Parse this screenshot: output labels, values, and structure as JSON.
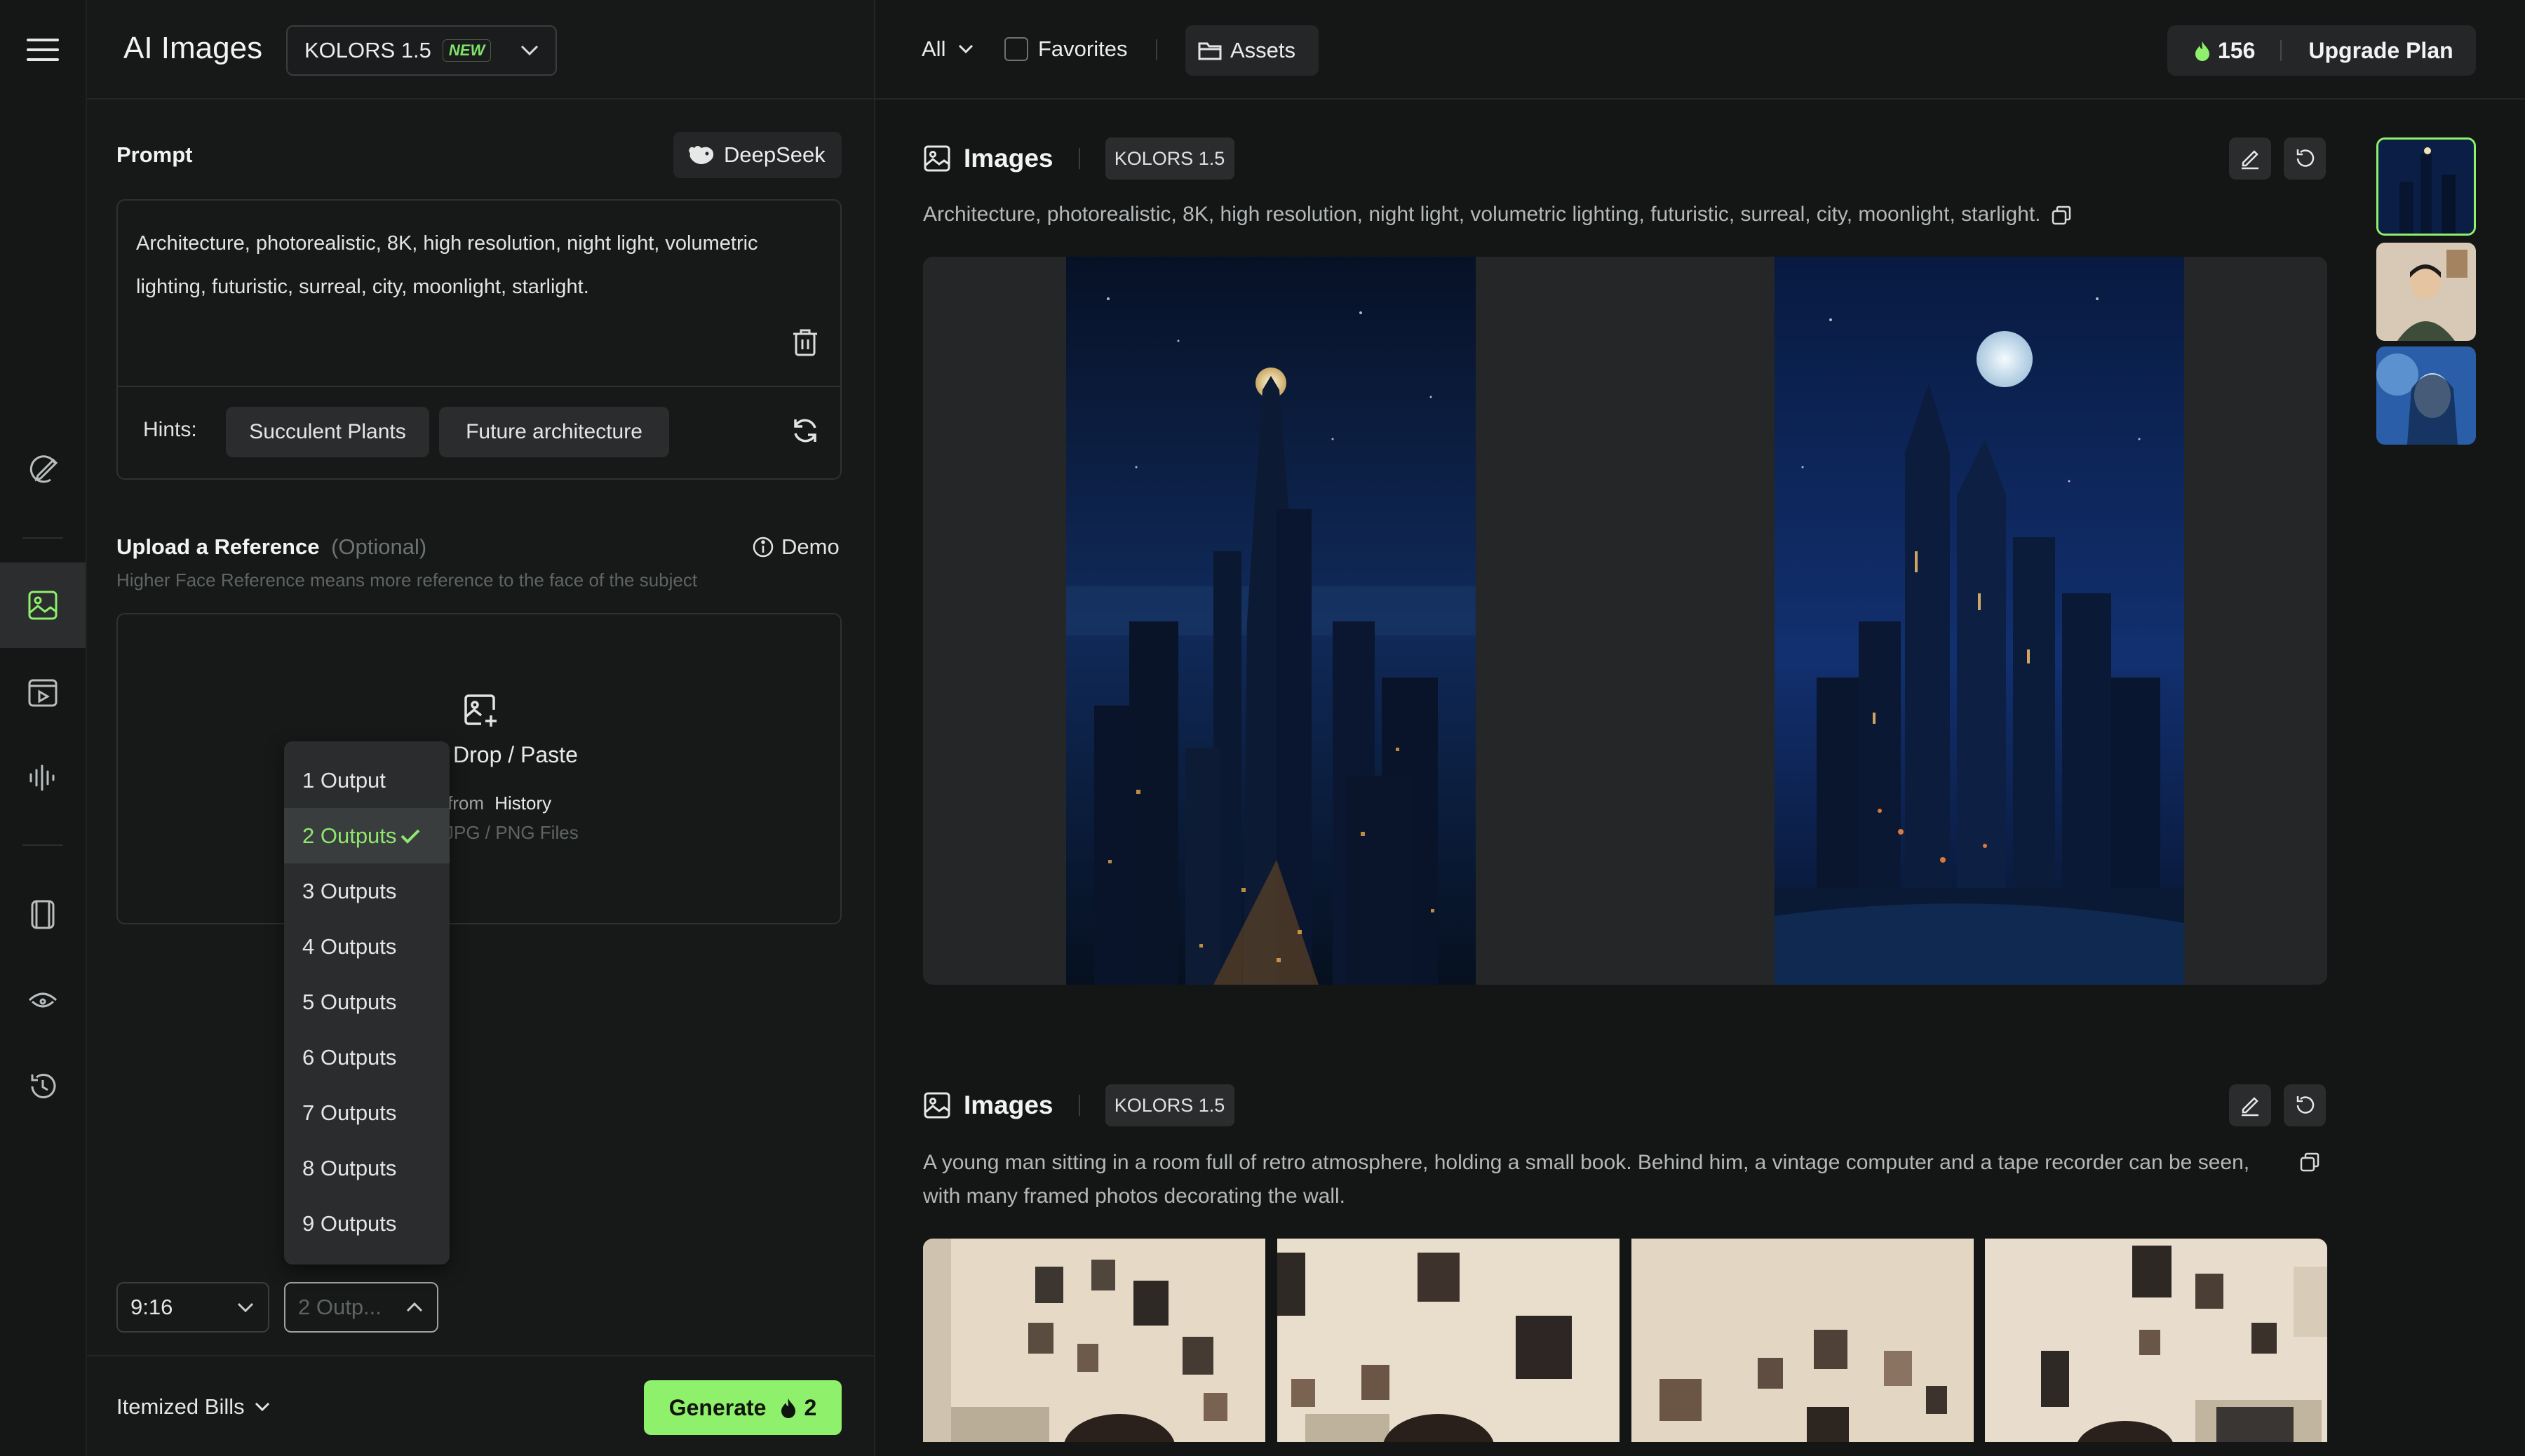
{
  "app": {
    "title": "AI Images",
    "model": "KOLORS 1.5",
    "new_badge": "NEW"
  },
  "prompt": {
    "label": "Prompt",
    "deepseek_label": "DeepSeek",
    "text": "Architecture, photorealistic, 8K, high resolution, night light, volumetric lighting, futuristic, surreal, city, moonlight, starlight.",
    "hints_label": "Hints:",
    "hints": [
      "Succulent Plants",
      "Future architecture"
    ]
  },
  "reference": {
    "label": "Upload a Reference",
    "optional": "(Optional)",
    "demo_label": "Demo",
    "help": "Higher Face Reference means more reference to the face of the subject",
    "drop_label": "Drop / Paste",
    "from_label": "from",
    "history_label": "History",
    "formats": "JPG / PNG Files"
  },
  "outputs_dropdown": {
    "options": [
      "1 Output",
      "2 Outputs",
      "3 Outputs",
      "4 Outputs",
      "5 Outputs",
      "6 Outputs",
      "7 Outputs",
      "8 Outputs",
      "9 Outputs"
    ],
    "selected": "2 Outputs"
  },
  "controls": {
    "aspect_ratio": "9:16",
    "outputs_value": "2 Outp..."
  },
  "footer": {
    "bills_label": "Itemized Bills",
    "generate_label": "Generate",
    "generate_cost": "2"
  },
  "topbar": {
    "filter_label": "All",
    "favorites_label": "Favorites",
    "assets_label": "Assets",
    "credits": "156",
    "upgrade_label": "Upgrade Plan"
  },
  "cards": [
    {
      "title": "Images",
      "model": "KOLORS 1.5",
      "prompt": "Architecture, photorealistic, 8K, high resolution, night light, volumetric lighting, futuristic, surreal, city, moonlight, starlight."
    },
    {
      "title": "Images",
      "model": "KOLORS 1.5",
      "prompt_line1": "A young man sitting in a room full of retro atmosphere, holding a small book. Behind him, a vintage computer and a tape recorder can be seen,",
      "prompt_line2": "with many framed photos decorating the wall."
    }
  ],
  "colors": {
    "accent": "#8ef06b",
    "background": "#141515",
    "panel": "#171818"
  }
}
